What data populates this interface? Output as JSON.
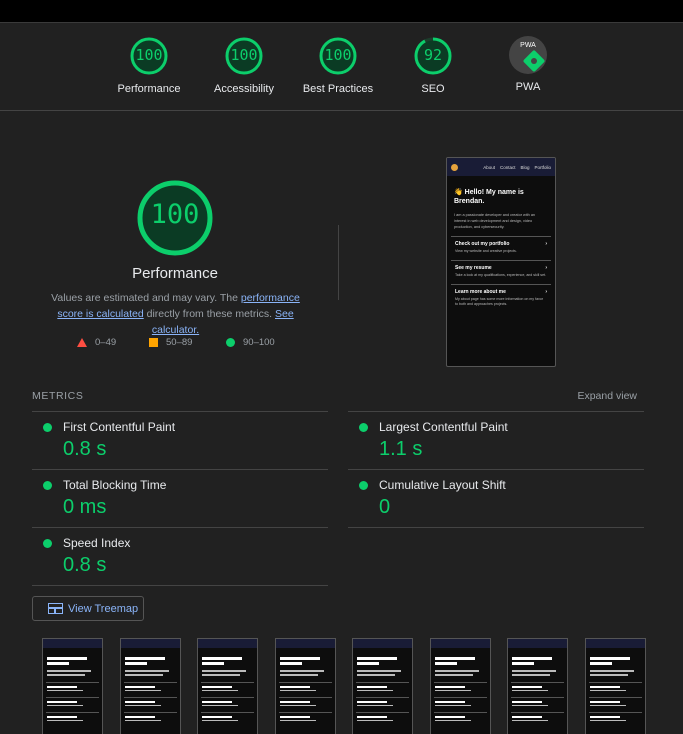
{
  "summary": [
    {
      "score": "100",
      "label": "Performance"
    },
    {
      "score": "100",
      "label": "Accessibility"
    },
    {
      "score": "100",
      "label": "Best Practices"
    },
    {
      "score": "92",
      "label": "SEO"
    },
    {
      "badge": "PWA",
      "label": "PWA"
    }
  ],
  "performance": {
    "score": "100",
    "title": "Performance",
    "desc_pre": "Values are estimated and may vary. The ",
    "desc_link": "performance score is calculated",
    "desc_mid": " directly from these metrics. ",
    "desc_calc": "See calculator."
  },
  "legend": {
    "fail": "0–49",
    "average": "50–89",
    "pass": "90–100"
  },
  "preview": {
    "nav_items": [
      "About",
      "Contact",
      "Blog",
      "Portfolio"
    ],
    "hello": "👋 Hello! My name is Brendan.",
    "intro": "I am a passionate developer and creator with an interest in web development and design, video production, and cybersecurity.",
    "cards": [
      {
        "title": "Check out my portfolio",
        "desc": "View my website and creative projects."
      },
      {
        "title": "See my resume",
        "desc": "Take a look at my qualifications, experience, and skill set."
      },
      {
        "title": "Learn more about me",
        "desc": "My about page has some more information on my favor to both and approaches projects."
      }
    ]
  },
  "metrics": {
    "heading": "METRICS",
    "expand": "Expand view",
    "items": [
      {
        "name": "First Contentful Paint",
        "value": "0.8 s"
      },
      {
        "name": "Largest Contentful Paint",
        "value": "1.1 s"
      },
      {
        "name": "Total Blocking Time",
        "value": "0 ms"
      },
      {
        "name": "Cumulative Layout Shift",
        "value": "0"
      },
      {
        "name": "Speed Index",
        "value": "0.8 s"
      }
    ]
  },
  "treemap": {
    "label": "View Treemap"
  },
  "colors": {
    "pass": "#0cce6b",
    "average": "#ffa400",
    "fail": "#ff4e42",
    "link": "#8ab4f8"
  }
}
